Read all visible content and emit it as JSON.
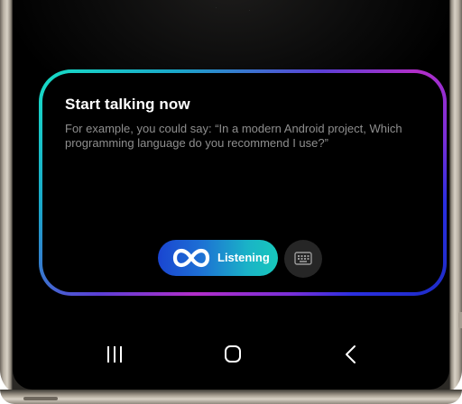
{
  "assistant": {
    "title": "Start talking now",
    "hint": "For example, you could say: “In a modern Android project, Which programming language do you recommend I use?”",
    "listening_label": "Listening",
    "listening_icon": "infinity-icon",
    "keyboard_icon": "keyboard-icon"
  },
  "navigation": {
    "recents_icon": "recents-icon",
    "home_icon": "home-icon",
    "back_icon": "back-icon"
  },
  "colors": {
    "screen_background": "#000000",
    "title_text": "#ffffff",
    "hint_text": "#8e8e8e",
    "border_gradient": [
      "#18e0c6",
      "#5c3fd6",
      "#b32ec9",
      "#2a2fe0"
    ],
    "listening_gradient": [
      "#1a45d1",
      "#17c8bb"
    ],
    "keyboard_button_bg": "#262626"
  }
}
